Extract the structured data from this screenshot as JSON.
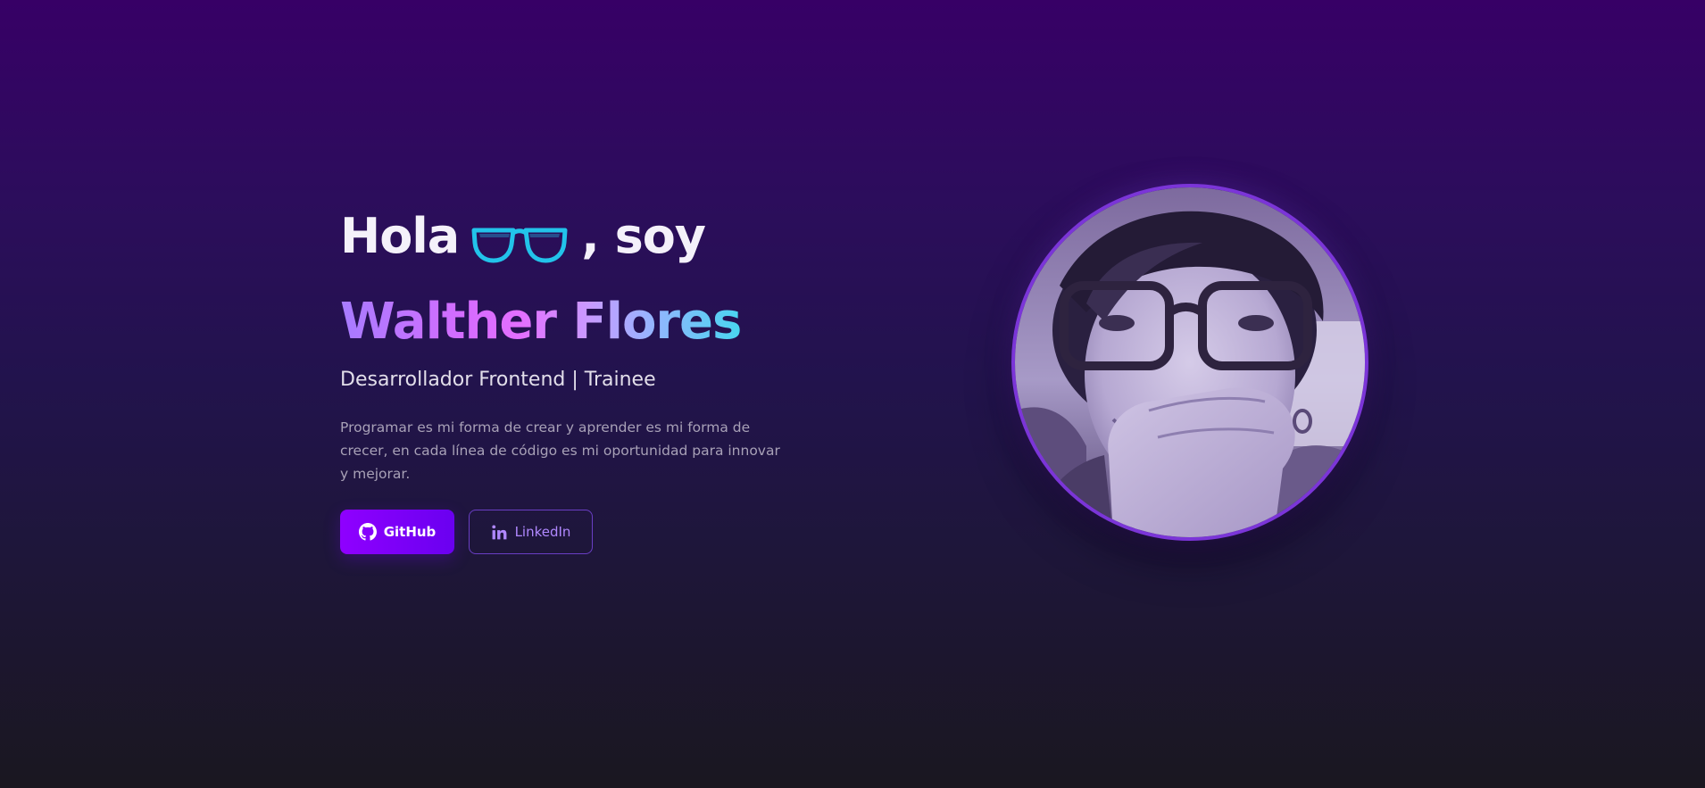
{
  "hero": {
    "greeting_start": "Hola",
    "greeting_end": ", soy",
    "name": "Walther Flores",
    "role": "Desarrollador Frontend | Trainee",
    "description": "Programar es mi forma de crear y aprender es mi forma de crecer, en cada línea de código es mi oportunidad para innovar y mejorar."
  },
  "buttons": {
    "github_label": "GitHub",
    "linkedin_label": "LinkedIn"
  },
  "icons": {
    "greeting_icon": "glasses-icon",
    "github_icon": "github-icon",
    "linkedin_icon": "linkedin-icon"
  },
  "colors": {
    "background_top": "#370066",
    "background_bottom": "#1a1720",
    "accent_purple": "#8f00ff",
    "accent_cyan": "#22c3ea",
    "avatar_border": "#7b35d8"
  }
}
